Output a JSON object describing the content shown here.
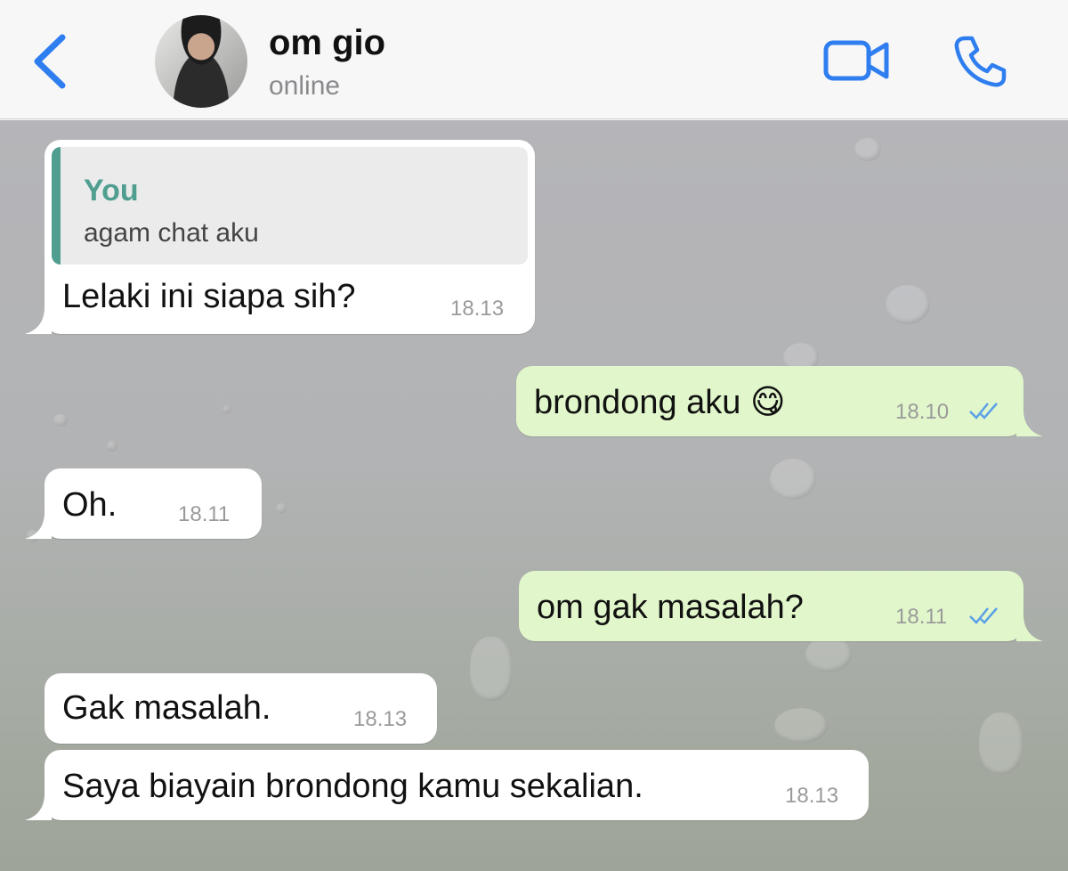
{
  "header": {
    "contact_name": "om gio",
    "status": "online",
    "accent_color": "#2f7ef0",
    "icons": [
      "back-chevron-icon",
      "video-call-icon",
      "voice-call-icon"
    ]
  },
  "messages": [
    {
      "direction": "incoming",
      "reply_to": {
        "sender": "You",
        "text": "agam chat aku"
      },
      "text": "Lelaki ini siapa sih?",
      "time": "18.13"
    },
    {
      "direction": "outgoing",
      "text": "brondong aku 😋",
      "time": "18.10",
      "status": "read"
    },
    {
      "direction": "incoming",
      "text": "Oh.",
      "time": "18.11"
    },
    {
      "direction": "outgoing",
      "text": "om gak masalah?",
      "time": "18.11",
      "status": "read"
    },
    {
      "direction": "incoming",
      "text": "Gak masalah.",
      "time": "18.13"
    },
    {
      "direction": "incoming",
      "text": "Saya biayain brondong kamu sekalian.",
      "time": "18.13"
    }
  ],
  "colors": {
    "incoming_bubble": "#ffffff",
    "outgoing_bubble": "#e1f7cb",
    "reply_accent": "#4f9e90",
    "read_ticks": "#5aa0e8"
  }
}
